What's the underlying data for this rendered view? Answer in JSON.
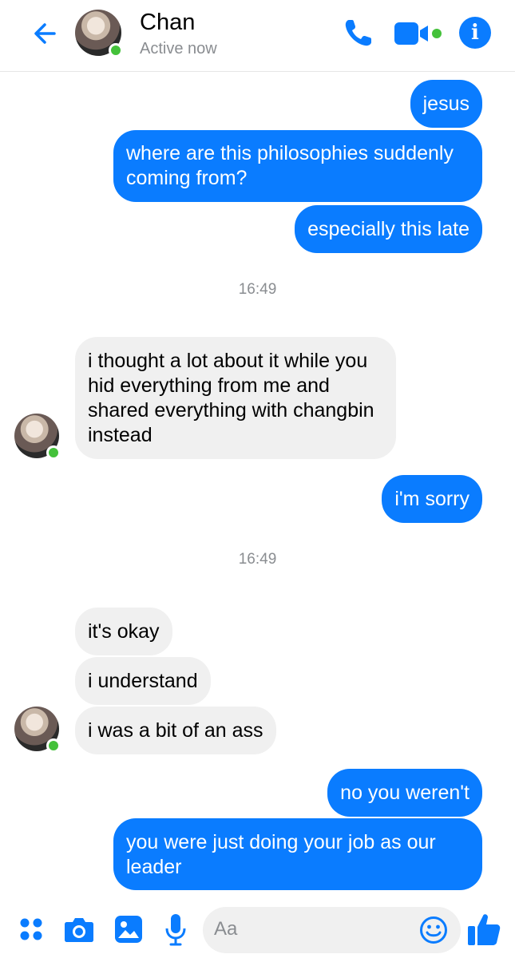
{
  "header": {
    "name": "Chan",
    "status": "Active now"
  },
  "messages": [
    {
      "dir": "out",
      "text": "jesus"
    },
    {
      "dir": "out",
      "text": "where are this philosophies suddenly coming from?"
    },
    {
      "dir": "out",
      "text": "especially this late"
    },
    {
      "type": "time",
      "text": "16:49"
    },
    {
      "dir": "in",
      "text": "i thought a lot about it while you hid everything from me and shared everything with changbin instead"
    },
    {
      "dir": "out",
      "text": "i'm sorry"
    },
    {
      "type": "time",
      "text": "16:49"
    },
    {
      "dir": "in",
      "text": "it's okay"
    },
    {
      "dir": "in",
      "text": "i understand"
    },
    {
      "dir": "in",
      "text": "i was a bit of an ass"
    },
    {
      "dir": "out",
      "text": "no you weren't"
    },
    {
      "dir": "out",
      "text": "you were just doing your job as our leader"
    }
  ],
  "composer": {
    "placeholder": "Aa"
  },
  "colors": {
    "accent": "#0a7cff",
    "incoming_bubble": "#f0f0f0",
    "online": "#44c13a"
  },
  "icons": [
    "back-arrow-icon",
    "phone-icon",
    "video-camera-icon",
    "info-icon",
    "apps-grid-icon",
    "camera-icon",
    "gallery-icon",
    "microphone-icon",
    "emoji-icon",
    "thumbs-up-icon"
  ]
}
